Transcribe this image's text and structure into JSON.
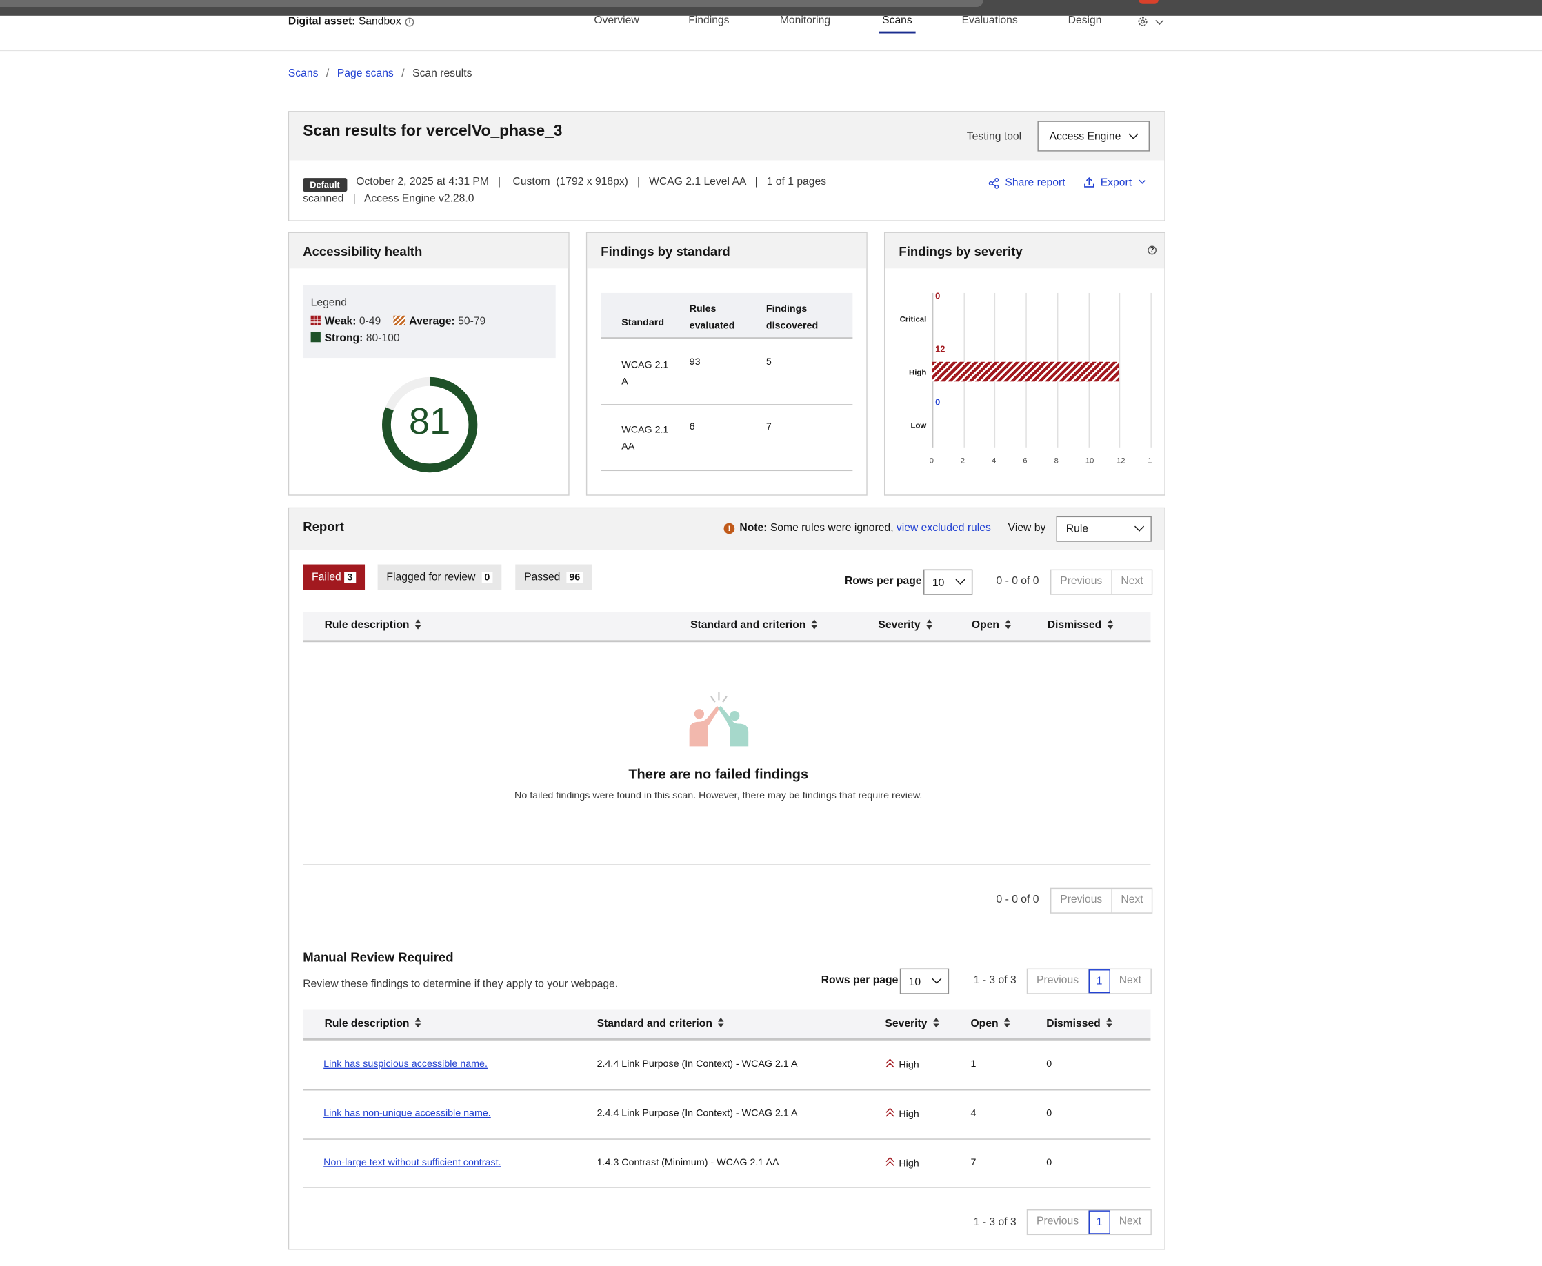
{
  "nav": {
    "asset_label": "Digital asset:",
    "asset_name": "Sandbox",
    "info": "i",
    "links": [
      "Overview",
      "Findings",
      "Monitoring",
      "Scans",
      "Evaluations",
      "Design"
    ],
    "active": "Scans"
  },
  "breadcrumb": [
    "Scans",
    "Page scans",
    "Scan results"
  ],
  "header": {
    "title": "Scan results for vercelVo_phase_3",
    "testing_tool_label": "Testing tool",
    "testing_tool_value": "Access Engine",
    "tag": "Default",
    "meta_line1": "October 2, 2025 at 4:31 PM   |    Custom  (1792 x 918px)   |   WCAG 2.1 Level AA   |   1 of 1 pages",
    "meta_line2": "scanned   |   Access Engine v2.28.0",
    "share_label": "Share report",
    "export_label": "Export"
  },
  "health": {
    "title": "Accessibility health",
    "legend_title": "Legend",
    "weak_label": "Weak:",
    "weak_range": "0-49",
    "average_label": "Average:",
    "average_range": "50-79",
    "strong_label": "Strong:",
    "strong_range": "80-100",
    "score": "81",
    "score_value": 81,
    "ring_color": "#1e5128"
  },
  "standards": {
    "title": "Findings by standard",
    "headers": [
      "Standard",
      "Rules evaluated",
      "Findings discovered"
    ],
    "rows": [
      {
        "standard_l1": "WCAG 2.1",
        "standard_l2": "A",
        "rules": "93",
        "findings": "5"
      },
      {
        "standard_l1": "WCAG 2.1",
        "standard_l2": "AA",
        "rules": "6",
        "findings": "7"
      }
    ]
  },
  "chart_data": {
    "type": "bar",
    "title": "Findings by severity",
    "categories": [
      "Critical",
      "High",
      "Low"
    ],
    "values": [
      0,
      12,
      0
    ],
    "value_labels": [
      "0",
      "12",
      "0"
    ],
    "label_colors": [
      "#a2191f",
      "#a2191f",
      "#2342d2"
    ],
    "xticks": [
      "0",
      "2",
      "4",
      "6",
      "8",
      "10",
      "12",
      "1"
    ],
    "xlim": [
      0,
      14
    ],
    "grid": true,
    "orientation": "horizontal",
    "bar_color": "#a2191f",
    "help": "?"
  },
  "report": {
    "title": "Report",
    "note_bold": "Note:",
    "note_text": "Some rules were ignored,",
    "note_link": "view excluded rules",
    "note_icon": "!",
    "view_by_label": "View by",
    "view_by_value": "Rule",
    "tabs": [
      {
        "label": "Failed",
        "count": "3"
      },
      {
        "label": "Flagged for review",
        "count": "0"
      },
      {
        "label": "Passed",
        "count": "96"
      }
    ],
    "rows_per_page_label": "Rows per page",
    "rows_per_page": "10",
    "range_text": "0 - 0 of 0",
    "prev": "Previous",
    "next": "Next",
    "columns": [
      "Rule description",
      "Standard and criterion",
      "Severity",
      "Open",
      "Dismissed"
    ],
    "empty_title": "There are no failed findings",
    "empty_text": "No failed findings were found in this scan. However, there may be findings that require review.",
    "bottom_range_text": "0 - 0 of 0"
  },
  "manual": {
    "title": "Manual Review Required",
    "subtitle": "Review these findings to determine if they apply to your webpage.",
    "rows_per_page_label": "Rows per page",
    "rows_per_page": "10",
    "range_text": "1 - 3 of 3",
    "page": "1",
    "prev": "Previous",
    "next": "Next",
    "columns": [
      "Rule description",
      "Standard and criterion",
      "Severity",
      "Open",
      "Dismissed"
    ],
    "rows": [
      {
        "rule": "Link has suspicious accessible name.",
        "criterion": "2.4.4 Link Purpose (In Context) - WCAG 2.1 A",
        "severity": "High",
        "open": "1",
        "dismissed": "0"
      },
      {
        "rule": "Link has non-unique accessible name.",
        "criterion": "2.4.4 Link Purpose (In Context) - WCAG 2.1 A",
        "severity": "High",
        "open": "4",
        "dismissed": "0"
      },
      {
        "rule": "Non-large text without sufficient contrast.",
        "criterion": "1.4.3 Contrast (Minimum) - WCAG 2.1 AA",
        "severity": "High",
        "open": "7",
        "dismissed": "0"
      }
    ],
    "bottom_range_text": "1 - 3 of 3"
  }
}
